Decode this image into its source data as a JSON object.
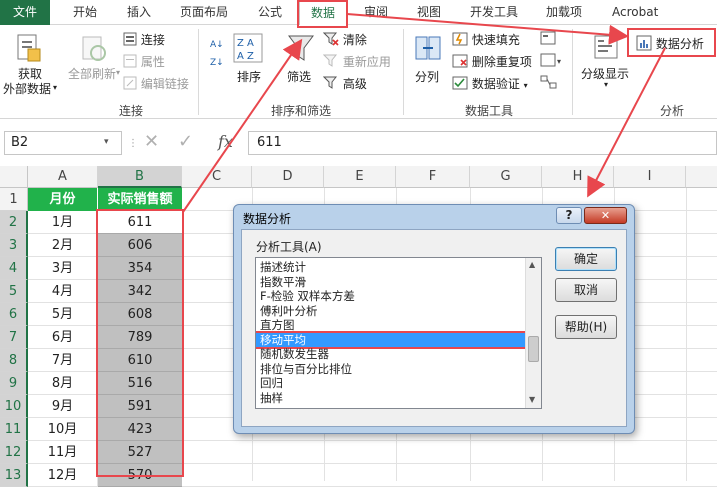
{
  "menu": {
    "file": "文件",
    "tabs": [
      "开始",
      "插入",
      "页面布局",
      "公式",
      "数据",
      "审阅",
      "视图",
      "开发工具",
      "加载项",
      "Acrobat"
    ]
  },
  "ribbon": {
    "get_external_line1": "获取",
    "get_external_line2": "外部数据",
    "refresh_all": "全部刷新",
    "connections": "连接",
    "properties": "属性",
    "edit_links": "编辑链接",
    "group_connections": "连接",
    "sort": "排序",
    "filter": "筛选",
    "clear": "清除",
    "reapply": "重新应用",
    "advanced": "高级",
    "group_sort_filter": "排序和筛选",
    "text_to_columns": "分列",
    "flash_fill": "快速填充",
    "remove_duplicates": "删除重复项",
    "data_validation": "数据验证",
    "group_data_tools": "数据工具",
    "outline": "分级显示",
    "data_analysis": "数据分析",
    "group_analysis": "分析"
  },
  "formula_bar": {
    "name_box": "B2",
    "fx": "fx",
    "value": "611"
  },
  "sheet": {
    "columns": [
      "A",
      "B",
      "C",
      "D",
      "E",
      "F",
      "G",
      "H",
      "I"
    ],
    "rows": [
      "1",
      "2",
      "3",
      "4",
      "5",
      "6",
      "7",
      "8",
      "9",
      "10",
      "11",
      "12",
      "13"
    ],
    "header_a": "月份",
    "header_b": "实际销售额",
    "months": [
      "1月",
      "2月",
      "3月",
      "4月",
      "5月",
      "6月",
      "7月",
      "8月",
      "9月",
      "10月",
      "11月",
      "12月"
    ],
    "sales": [
      "611",
      "606",
      "354",
      "342",
      "608",
      "789",
      "610",
      "516",
      "591",
      "423",
      "527",
      "570"
    ]
  },
  "dialog": {
    "title": "数据分析",
    "help_glyph": "?",
    "close_glyph": "✕",
    "list_label": "分析工具(A)",
    "tools": [
      "描述统计",
      "指数平滑",
      "F-检验 双样本方差",
      "傅利叶分析",
      "直方图",
      "移动平均",
      "随机数发生器",
      "排位与百分比排位",
      "回归",
      "抽样"
    ],
    "selected": "移动平均",
    "ok": "确定",
    "cancel": "取消",
    "help": "帮助(H)"
  },
  "colors": {
    "excel_green": "#217346",
    "header_green": "#21b24b",
    "highlight_red": "#e8474d",
    "selection_blue": "#3399ff"
  }
}
